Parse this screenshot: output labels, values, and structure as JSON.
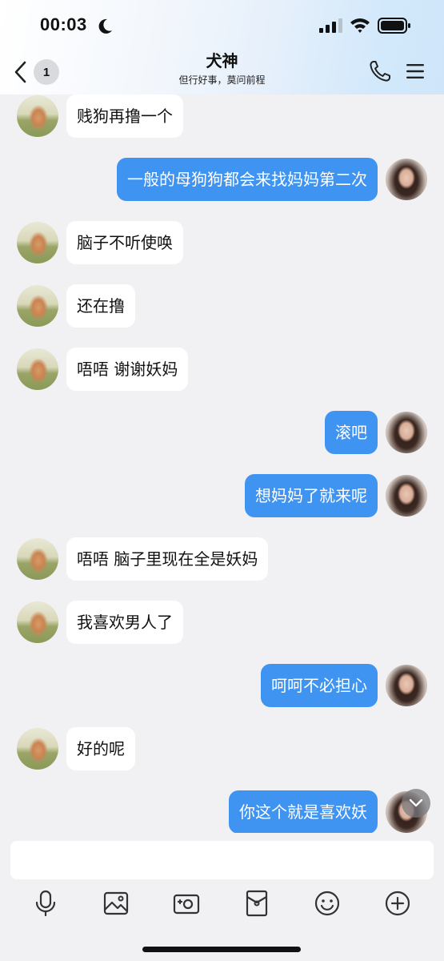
{
  "status_bar": {
    "time": "00:03"
  },
  "header": {
    "back_count": "1",
    "title": "犬神",
    "subtitle": "但行好事，莫问前程"
  },
  "messages": [
    {
      "side": "in",
      "avatar": "dog-avatar",
      "text": "贱狗再撸一个"
    },
    {
      "side": "out",
      "avatar": "girl-avatar",
      "text": "一般的母狗狗都会来找妈妈第二次"
    },
    {
      "side": "in",
      "avatar": "dog-avatar",
      "text": "脑子不听使唤"
    },
    {
      "side": "in",
      "avatar": "dog-avatar",
      "text": "还在撸"
    },
    {
      "side": "in",
      "avatar": "dog-avatar",
      "text": "唔唔 谢谢妖妈"
    },
    {
      "side": "out",
      "avatar": "girl-avatar",
      "text": "滚吧"
    },
    {
      "side": "out",
      "avatar": "girl-avatar",
      "text": "想妈妈了就来呢"
    },
    {
      "side": "in",
      "avatar": "dog-avatar",
      "text": "唔唔 脑子里现在全是妖妈"
    },
    {
      "side": "in",
      "avatar": "dog-avatar",
      "text": "我喜欢男人了"
    },
    {
      "side": "out",
      "avatar": "girl-avatar",
      "text": "呵呵不必担心"
    },
    {
      "side": "in",
      "avatar": "dog-avatar",
      "text": "好的呢"
    },
    {
      "side": "out",
      "avatar": "girl-avatar",
      "text": "你这个就是喜欢妖"
    }
  ],
  "composer": {
    "input_value": "",
    "tools": [
      "microphone-icon",
      "image-icon",
      "camera-icon",
      "red-packet-icon",
      "emoji-icon",
      "plus-icon"
    ]
  },
  "colors": {
    "outgoing_bubble": "#3f94f2",
    "incoming_bubble": "#ffffff",
    "background": "#f1f1f3"
  }
}
